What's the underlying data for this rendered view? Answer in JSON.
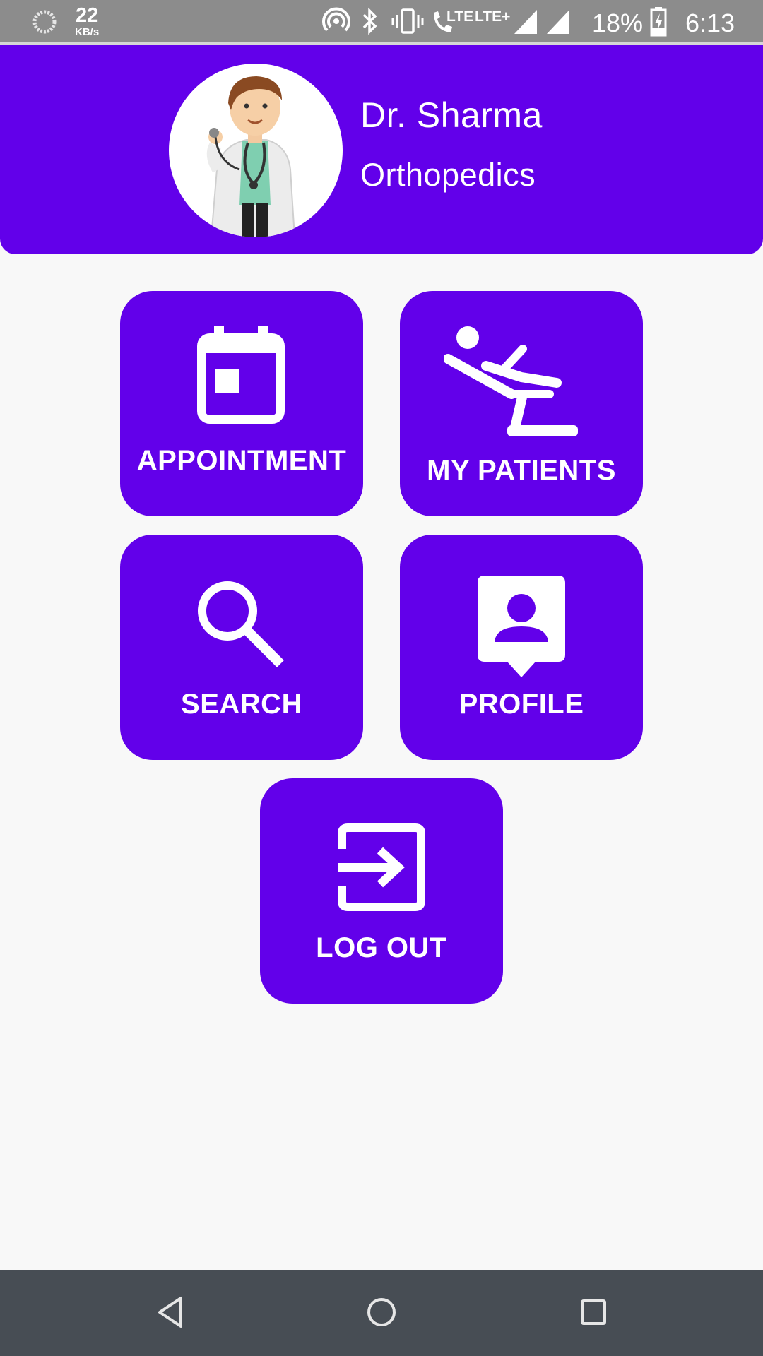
{
  "status_bar": {
    "speed_value": "22",
    "speed_unit": "KB/s",
    "lte_label": "LTE",
    "lte_plus_label": "LTE+",
    "battery_percent": "18%",
    "time": "6:13"
  },
  "header": {
    "doctor_name": "Dr. Sharma",
    "specialty": "Orthopedics"
  },
  "menu": {
    "appointment": "APPOINTMENT",
    "my_patients": "MY PATIENTS",
    "search": "SEARCH",
    "profile": "PROFILE",
    "logout": "LOG OUT"
  },
  "colors": {
    "primary": "#6200ea",
    "background": "#f8f8f8",
    "status_bar": "#8c8c8c",
    "nav_bar": "#474d54"
  },
  "icons": {
    "appointment": "calendar-icon",
    "my_patients": "dental-chair-patient-icon",
    "search": "magnifier-icon",
    "profile": "contact-card-icon",
    "logout": "exit-arrow-icon"
  }
}
